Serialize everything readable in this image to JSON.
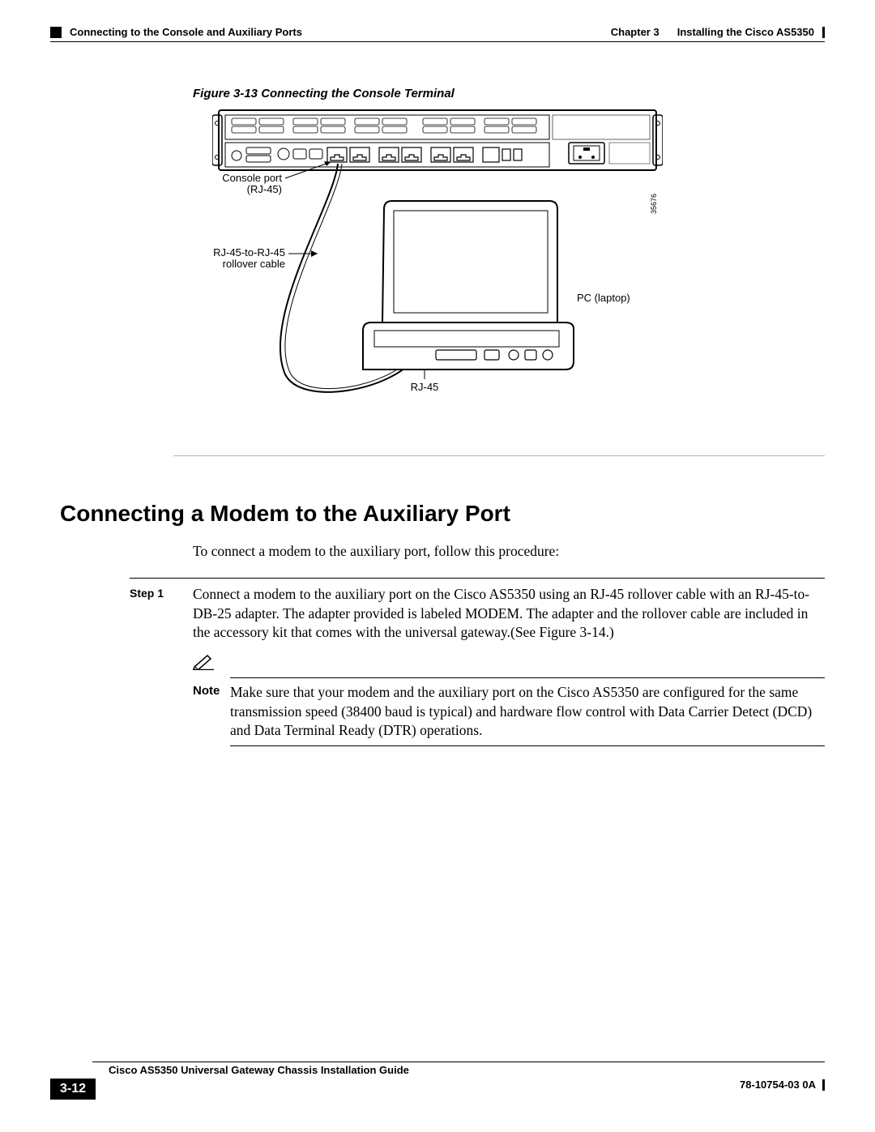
{
  "header": {
    "section_title": "Connecting to the Console and Auxiliary Ports",
    "chapter_label": "Chapter 3",
    "chapter_title": "Installing the Cisco AS5350"
  },
  "figure": {
    "caption": "Figure 3-13   Connecting the Console Terminal",
    "labels": {
      "console_port_line1": "Console port",
      "console_port_line2": "(RJ-45)",
      "rollover_line1": "RJ-45-to-RJ-45",
      "rollover_line2": "rollover cable",
      "pc_laptop": "PC (laptop)",
      "rj45": "RJ-45",
      "image_id": "35676"
    }
  },
  "section_heading": "Connecting a Modem to the Auxiliary Port",
  "intro": "To connect a modem to the auxiliary port, follow this procedure:",
  "step1": {
    "label": "Step 1",
    "text": "Connect a modem to the auxiliary port on the Cisco AS5350 using an RJ-45 rollover cable with an RJ-45-to-DB-25 adapter. The adapter provided is labeled MODEM. The adapter and the rollover cable are included in the accessory kit that comes with the universal gateway.(See Figure 3-14.)"
  },
  "note": {
    "label": "Note",
    "text": "Make sure that your modem and the auxiliary port on the Cisco AS5350 are configured for the same transmission speed (38400 baud is typical) and hardware flow control with Data Carrier Detect (DCD) and Data Terminal Ready (DTR) operations."
  },
  "footer": {
    "guide_title": "Cisco AS5350 Universal Gateway Chassis Installation Guide",
    "page_number": "3-12",
    "pub_number": "78-10754-03 0A"
  }
}
